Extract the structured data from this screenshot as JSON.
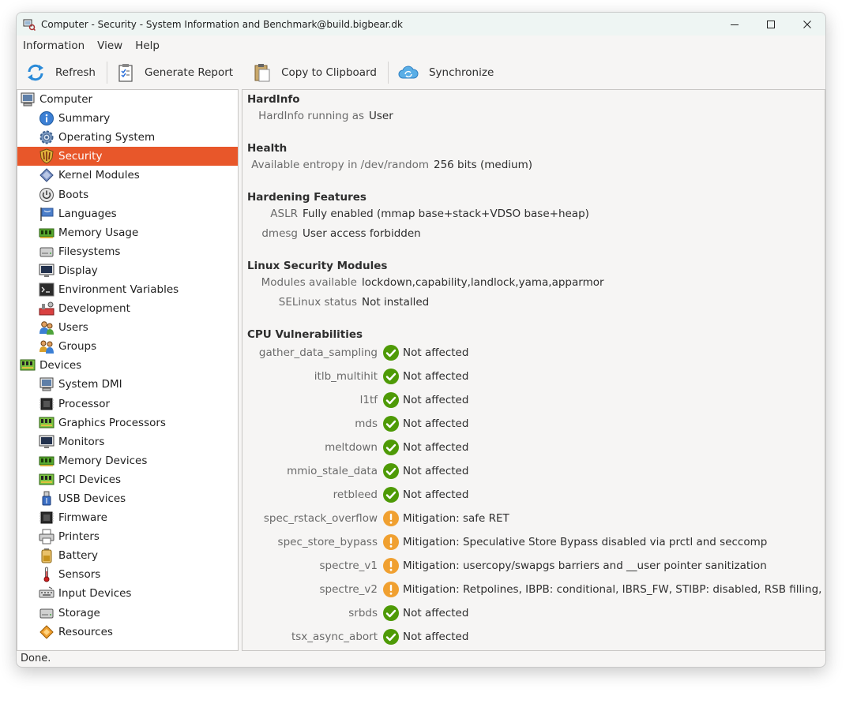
{
  "window": {
    "title": "Computer - Security - System Information and Benchmark@build.bigbear.dk"
  },
  "menu": {
    "items": [
      "Information",
      "View",
      "Help"
    ]
  },
  "toolbar": {
    "refresh": "Refresh",
    "generate_report": "Generate Report",
    "copy_clipboard": "Copy to Clipboard",
    "synchronize": "Synchronize"
  },
  "sidebar": {
    "categories": [
      {
        "label": "Computer",
        "icon": "computer-icon",
        "items": [
          {
            "label": "Summary",
            "icon": "info-icon"
          },
          {
            "label": "Operating System",
            "icon": "gear-icon"
          },
          {
            "label": "Security",
            "icon": "shield-icon",
            "selected": true
          },
          {
            "label": "Kernel Modules",
            "icon": "module-icon"
          },
          {
            "label": "Boots",
            "icon": "power-icon"
          },
          {
            "label": "Languages",
            "icon": "flag-icon"
          },
          {
            "label": "Memory Usage",
            "icon": "memory-icon"
          },
          {
            "label": "Filesystems",
            "icon": "disk-icon"
          },
          {
            "label": "Display",
            "icon": "monitor-icon"
          },
          {
            "label": "Environment Variables",
            "icon": "terminal-icon"
          },
          {
            "label": "Development",
            "icon": "development-icon"
          },
          {
            "label": "Users",
            "icon": "users-icon"
          },
          {
            "label": "Groups",
            "icon": "groups-icon"
          }
        ]
      },
      {
        "label": "Devices",
        "icon": "board-icon",
        "items": [
          {
            "label": "System DMI",
            "icon": "computer-icon"
          },
          {
            "label": "Processor",
            "icon": "chip-icon"
          },
          {
            "label": "Graphics Processors",
            "icon": "board-icon"
          },
          {
            "label": "Monitors",
            "icon": "monitor-icon"
          },
          {
            "label": "Memory Devices",
            "icon": "memory-icon"
          },
          {
            "label": "PCI Devices",
            "icon": "board-icon"
          },
          {
            "label": "USB Devices",
            "icon": "usb-icon"
          },
          {
            "label": "Firmware",
            "icon": "chip-icon"
          },
          {
            "label": "Printers",
            "icon": "printer-icon"
          },
          {
            "label": "Battery",
            "icon": "battery-icon"
          },
          {
            "label": "Sensors",
            "icon": "thermometer-icon"
          },
          {
            "label": "Input Devices",
            "icon": "keyboard-icon"
          },
          {
            "label": "Storage",
            "icon": "disk-icon"
          },
          {
            "label": "Resources",
            "icon": "resources-icon"
          }
        ]
      }
    ]
  },
  "content": {
    "sections": [
      {
        "title": "HardInfo",
        "rows": [
          {
            "key": "HardInfo running as",
            "value": "User"
          }
        ]
      },
      {
        "title": "Health",
        "rows": [
          {
            "key": "Available entropy in /dev/random",
            "value": "256 bits (medium)"
          }
        ]
      },
      {
        "title": "Hardening Features",
        "rows": [
          {
            "key": "ASLR",
            "value": "Fully enabled (mmap base+stack+VDSO base+heap)"
          },
          {
            "key": "dmesg",
            "value": "User access forbidden"
          }
        ]
      },
      {
        "title": "Linux Security Modules",
        "rows": [
          {
            "key": "Modules available",
            "value": "lockdown,capability,landlock,yama,apparmor"
          },
          {
            "key": "SELinux status",
            "value": "Not installed"
          }
        ]
      },
      {
        "title": "CPU Vulnerabilities",
        "rows": [
          {
            "key": "gather_data_sampling",
            "value": "Not affected",
            "status": "ok"
          },
          {
            "key": "itlb_multihit",
            "value": "Not affected",
            "status": "ok"
          },
          {
            "key": "l1tf",
            "value": "Not affected",
            "status": "ok"
          },
          {
            "key": "mds",
            "value": "Not affected",
            "status": "ok"
          },
          {
            "key": "meltdown",
            "value": "Not affected",
            "status": "ok"
          },
          {
            "key": "mmio_stale_data",
            "value": "Not affected",
            "status": "ok"
          },
          {
            "key": "retbleed",
            "value": "Not affected",
            "status": "ok"
          },
          {
            "key": "spec_rstack_overflow",
            "value": "Mitigation: safe RET",
            "status": "warn"
          },
          {
            "key": "spec_store_bypass",
            "value": "Mitigation: Speculative Store Bypass disabled via prctl and seccomp",
            "status": "warn"
          },
          {
            "key": "spectre_v1",
            "value": "Mitigation: usercopy/swapgs barriers and __user pointer sanitization",
            "status": "warn"
          },
          {
            "key": "spectre_v2",
            "value": "Mitigation: Retpolines, IBPB: conditional, IBRS_FW, STIBP: disabled, RSB filling, PBRSB-eIBRS: Not affected",
            "status": "warn"
          },
          {
            "key": "srbds",
            "value": "Not affected",
            "status": "ok"
          },
          {
            "key": "tsx_async_abort",
            "value": "Not affected",
            "status": "ok"
          }
        ]
      }
    ]
  },
  "statusbar": {
    "text": "Done."
  },
  "colors": {
    "selection": "#e8572a",
    "ok": "#4e9a06",
    "warn": "#f0a030"
  }
}
